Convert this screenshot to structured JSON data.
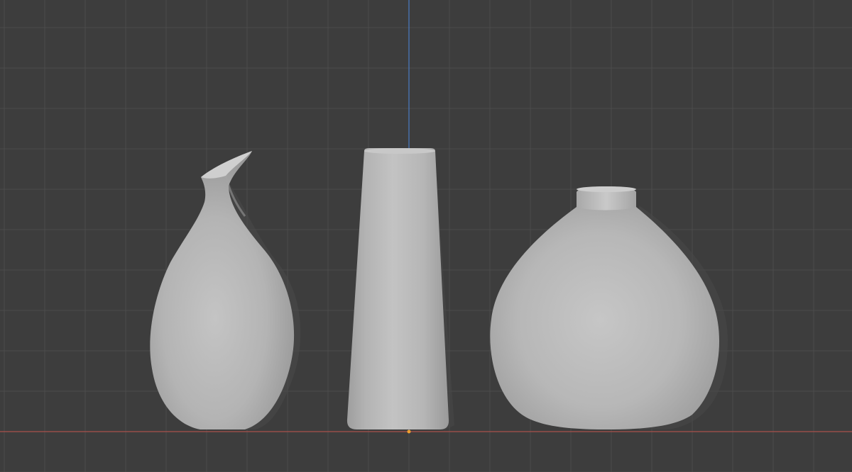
{
  "viewport": {
    "background_color": "#3d3d3d",
    "grid_color": "#4b4b4b",
    "axis_x_color": "#a9514d",
    "axis_z_color": "#4a7cc4",
    "origin_color": "#f0a030",
    "grid_visible": true,
    "shading": "solid",
    "view": "front-orthographic"
  },
  "scene": {
    "objects": [
      {
        "name": "pitcher-vase",
        "type": "mesh",
        "material_color": "#bdbdbd"
      },
      {
        "name": "cylinder-vase",
        "type": "mesh",
        "material_color": "#bdbdbd"
      },
      {
        "name": "round-vase",
        "type": "mesh",
        "material_color": "#bdbdbd"
      }
    ]
  }
}
